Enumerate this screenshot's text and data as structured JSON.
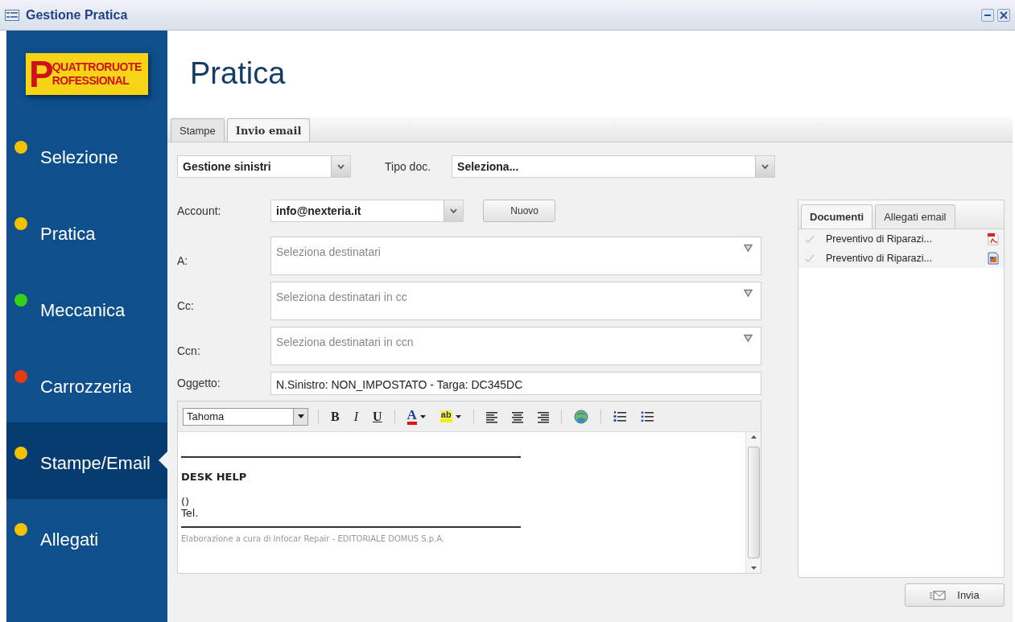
{
  "window": {
    "title": "Gestione Pratica"
  },
  "logo": {
    "initial": "P",
    "lines": [
      "QUATTRORUOTE",
      "ROFESSIONAL"
    ]
  },
  "sidebar": {
    "items": [
      {
        "label": "Selezione",
        "color": "#f2c200",
        "selected": false
      },
      {
        "label": "Pratica",
        "color": "#f2c200",
        "selected": false
      },
      {
        "label": "Meccanica",
        "color": "#33d11a",
        "selected": false
      },
      {
        "label": "Carrozzeria",
        "color": "#e83a10",
        "selected": false
      },
      {
        "label": "Stampe/Email",
        "color": "#f2c200",
        "selected": true
      },
      {
        "label": "Allegati",
        "color": "#f2c200",
        "selected": false
      }
    ]
  },
  "page_title": "Pratica",
  "tabs": [
    {
      "label": "Stampe",
      "selected": false
    },
    {
      "label": "Invio email",
      "selected": true
    }
  ],
  "category": {
    "value": "Gestione sinistri"
  },
  "doc_type": {
    "label": "Tipo doc.",
    "value": "Seleziona..."
  },
  "account": {
    "label": "Account:",
    "value": "info@nexteria.it",
    "button": "Nuovo"
  },
  "recipients": [
    {
      "label": "A:",
      "placeholder": "Seleziona destinatari"
    },
    {
      "label": "Cc:",
      "placeholder": "Seleziona destinatari in cc"
    },
    {
      "label": "Ccn:",
      "placeholder": "Seleziona destinatari in ccn"
    }
  ],
  "subject": {
    "label": "Oggetto:",
    "value": "N.Sinistro: NON_IMPOSTATO - Targa: DC345DC"
  },
  "toolbar": {
    "font": "Tahoma",
    "bold": "B",
    "italic": "I",
    "underline": "U",
    "font_color": "A",
    "highlight": "ab"
  },
  "editor": {
    "lines": [
      {
        "kind": "rule"
      },
      {
        "kind": "heading",
        "text": "DESK HELP"
      },
      {
        "kind": "text",
        "text": "()"
      },
      {
        "kind": "text",
        "text": "Tel."
      },
      {
        "kind": "rule"
      },
      {
        "kind": "footer",
        "text": "Elaborazione a cura di Infocar Repair - EDITORIALE DOMUS S.p.A."
      }
    ]
  },
  "attachments": {
    "tabs": [
      {
        "label": "Documenti",
        "selected": true
      },
      {
        "label": "Allegati email",
        "selected": false
      }
    ],
    "items": [
      {
        "name": "Preventivo di Riparazi...",
        "kind": "pdf"
      },
      {
        "name": "Preventivo di Riparazi...",
        "kind": "image"
      }
    ]
  },
  "send_button": "Invia"
}
